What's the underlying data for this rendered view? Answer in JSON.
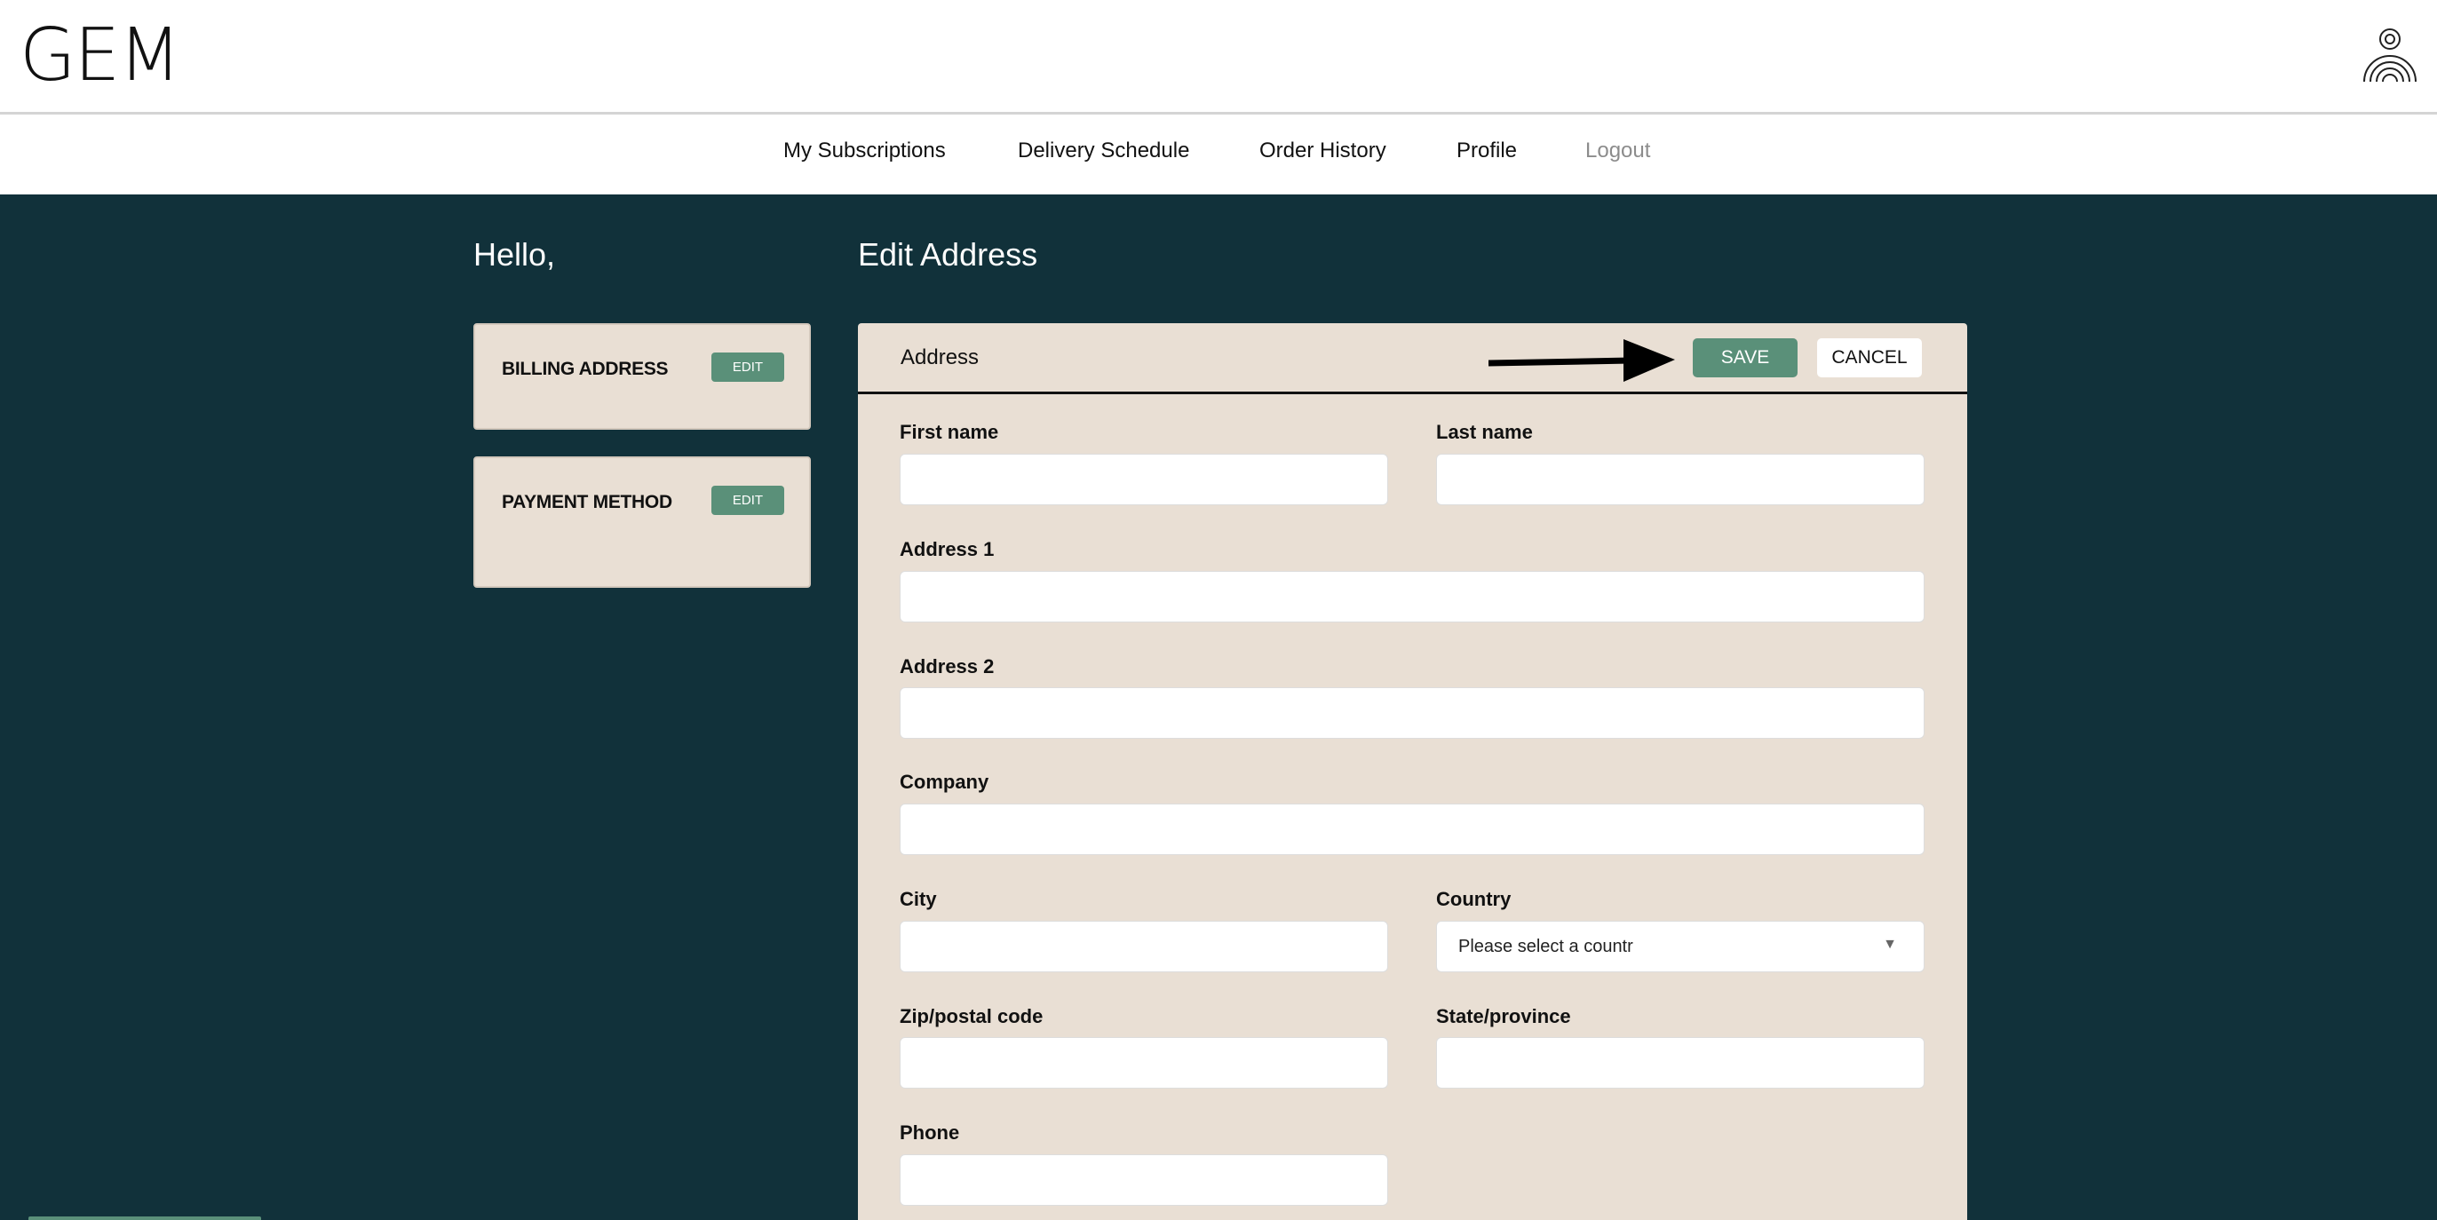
{
  "brand": {
    "logo_text": "GEM",
    "avatar_icon": "user-rainbow-icon"
  },
  "nav": {
    "items": [
      {
        "label": "My Subscriptions"
      },
      {
        "label": "Delivery Schedule"
      },
      {
        "label": "Order History"
      },
      {
        "label": "Profile"
      },
      {
        "label": "Logout"
      }
    ]
  },
  "greeting": "Hello,",
  "page_title": "Edit Address",
  "sidebar": {
    "cards": [
      {
        "title": "BILLING ADDRESS",
        "button": "EDIT"
      },
      {
        "title": "PAYMENT METHOD",
        "button": "EDIT"
      }
    ]
  },
  "form": {
    "section_title": "Address",
    "save_label": "SAVE",
    "cancel_label": "CANCEL",
    "fields": {
      "first_name": {
        "label": "First name",
        "value": ""
      },
      "last_name": {
        "label": "Last name",
        "value": ""
      },
      "address1": {
        "label": "Address 1",
        "value": ""
      },
      "address2": {
        "label": "Address 2",
        "value": ""
      },
      "company": {
        "label": "Company",
        "value": ""
      },
      "city": {
        "label": "City",
        "value": ""
      },
      "country": {
        "label": "Country",
        "selected": "Please select a countr"
      },
      "zip": {
        "label": "Zip/postal code",
        "value": ""
      },
      "state": {
        "label": "State/province",
        "value": ""
      },
      "phone": {
        "label": "Phone",
        "value": ""
      }
    }
  },
  "colors": {
    "page_bg": "#11313a",
    "card_bg": "#e9dfd4",
    "accent_green": "#5a9079"
  }
}
